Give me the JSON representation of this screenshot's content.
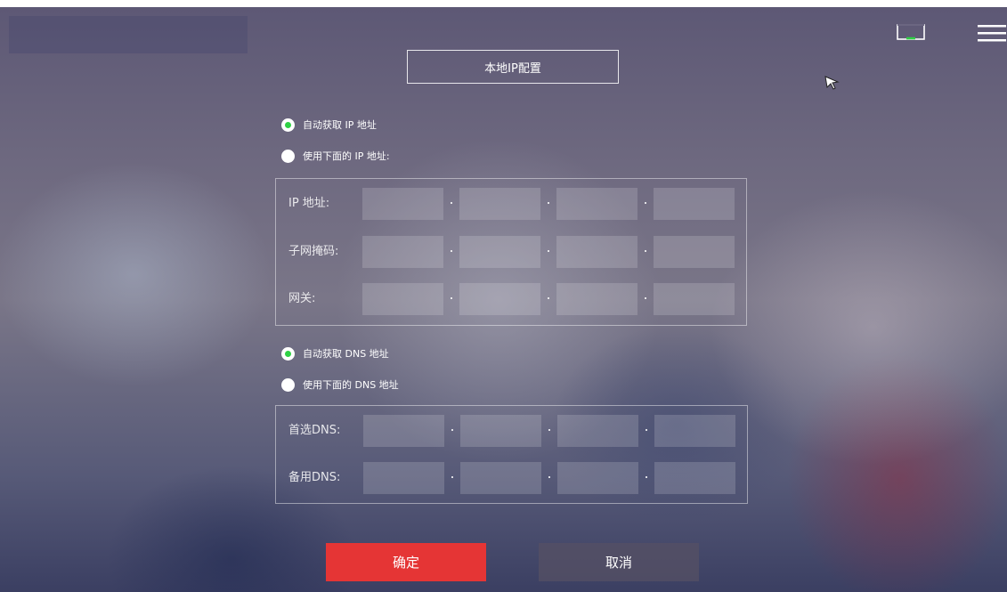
{
  "title": "本地IP配置",
  "ip_mode": {
    "auto_label": "自动获取 IP 地址",
    "manual_label": "使用下面的 IP 地址:",
    "selected": "auto"
  },
  "ip_fields": {
    "ip_label": "IP 地址:",
    "subnet_label": "子网掩码:",
    "gateway_label": "网关:"
  },
  "dns_mode": {
    "auto_label": "自动获取 DNS 地址",
    "manual_label": "使用下面的 DNS 地址",
    "selected": "auto"
  },
  "dns_fields": {
    "preferred_label": "首选DNS:",
    "alternate_label": "备用DNS:"
  },
  "buttons": {
    "ok": "确定",
    "cancel": "取消"
  },
  "colors": {
    "accent_ok": "#e53535",
    "radio_selected": "#2fd145"
  },
  "icons": [
    "monitor-icon",
    "menu-icon",
    "cursor-icon"
  ]
}
